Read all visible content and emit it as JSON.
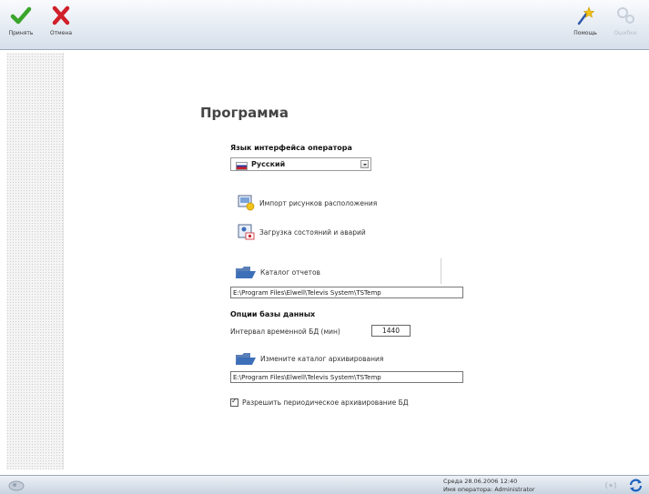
{
  "toolbar": {
    "apply_label": "Принять",
    "cancel_label": "Отмена",
    "help_label": "Помощь",
    "disabled_label": "Ошибки"
  },
  "page": {
    "title": "Программа",
    "language_label": "Язык интерфейса оператора",
    "language_value": "Русский",
    "import_label": "Импорт рисунков расположения",
    "load_label": "Загрузка состояний и аварий",
    "reports_label": "Каталог отчетов",
    "reports_path": "E:\\Program Files\\Elwell\\Televis System\\TSTemp",
    "db_options_label": "Опции базы данных",
    "interval_label": "Интервал временной БД (мин)",
    "interval_value": "1440",
    "archive_label": "Измените каталог архивирования",
    "archive_path": "E:\\Program Files\\Elwell\\Televis System\\TSTemp",
    "periodic_label": "Разрешить периодическое архивирование БД",
    "periodic_checked": true
  },
  "status": {
    "datetime": "Среда   28.06.2006    12:40",
    "operator": "Имя оператора:  Administrator"
  },
  "colors": {
    "apply": "#3aa52c",
    "cancel": "#d0202a",
    "folder": "#3d6fb8"
  },
  "icons": [
    "check-icon",
    "cross-icon",
    "help-wand-icon",
    "gear-icon",
    "flag-icon",
    "folder-icon",
    "refresh-icon",
    "network-icon"
  ]
}
